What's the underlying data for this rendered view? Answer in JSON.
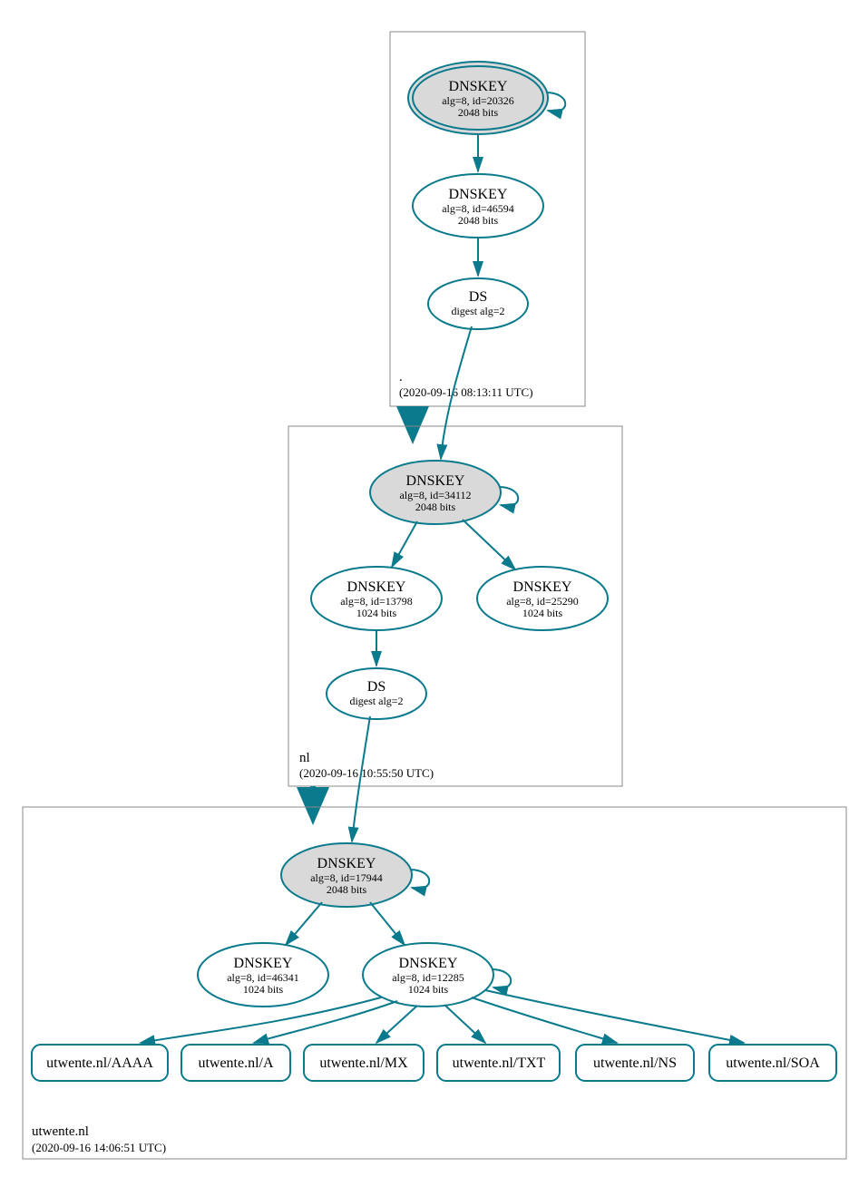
{
  "zones": {
    "root": {
      "label": ".",
      "timestamp": "(2020-09-16 08:13:11 UTC)"
    },
    "nl": {
      "label": "nl",
      "timestamp": "(2020-09-16 10:55:50 UTC)"
    },
    "ut": {
      "label": "utwente.nl",
      "timestamp": "(2020-09-16 14:06:51 UTC)"
    }
  },
  "nodes": {
    "root_ksk": {
      "title": "DNSKEY",
      "sub1": "alg=8, id=20326",
      "sub2": "2048 bits"
    },
    "root_zsk": {
      "title": "DNSKEY",
      "sub1": "alg=8, id=46594",
      "sub2": "2048 bits"
    },
    "root_ds": {
      "title": "DS",
      "sub1": "digest alg=2"
    },
    "nl_ksk": {
      "title": "DNSKEY",
      "sub1": "alg=8, id=34112",
      "sub2": "2048 bits"
    },
    "nl_zsk1": {
      "title": "DNSKEY",
      "sub1": "alg=8, id=13798",
      "sub2": "1024 bits"
    },
    "nl_zsk2": {
      "title": "DNSKEY",
      "sub1": "alg=8, id=25290",
      "sub2": "1024 bits"
    },
    "nl_ds": {
      "title": "DS",
      "sub1": "digest alg=2"
    },
    "ut_ksk": {
      "title": "DNSKEY",
      "sub1": "alg=8, id=17944",
      "sub2": "2048 bits"
    },
    "ut_zsk1": {
      "title": "DNSKEY",
      "sub1": "alg=8, id=46341",
      "sub2": "1024 bits"
    },
    "ut_zsk2": {
      "title": "DNSKEY",
      "sub1": "alg=8, id=12285",
      "sub2": "1024 bits"
    },
    "ut_aaaa": {
      "label": "utwente.nl/AAAA"
    },
    "ut_a": {
      "label": "utwente.nl/A"
    },
    "ut_mx": {
      "label": "utwente.nl/MX"
    },
    "ut_txt": {
      "label": "utwente.nl/TXT"
    },
    "ut_ns": {
      "label": "utwente.nl/NS"
    },
    "ut_soa": {
      "label": "utwente.nl/SOA"
    }
  }
}
